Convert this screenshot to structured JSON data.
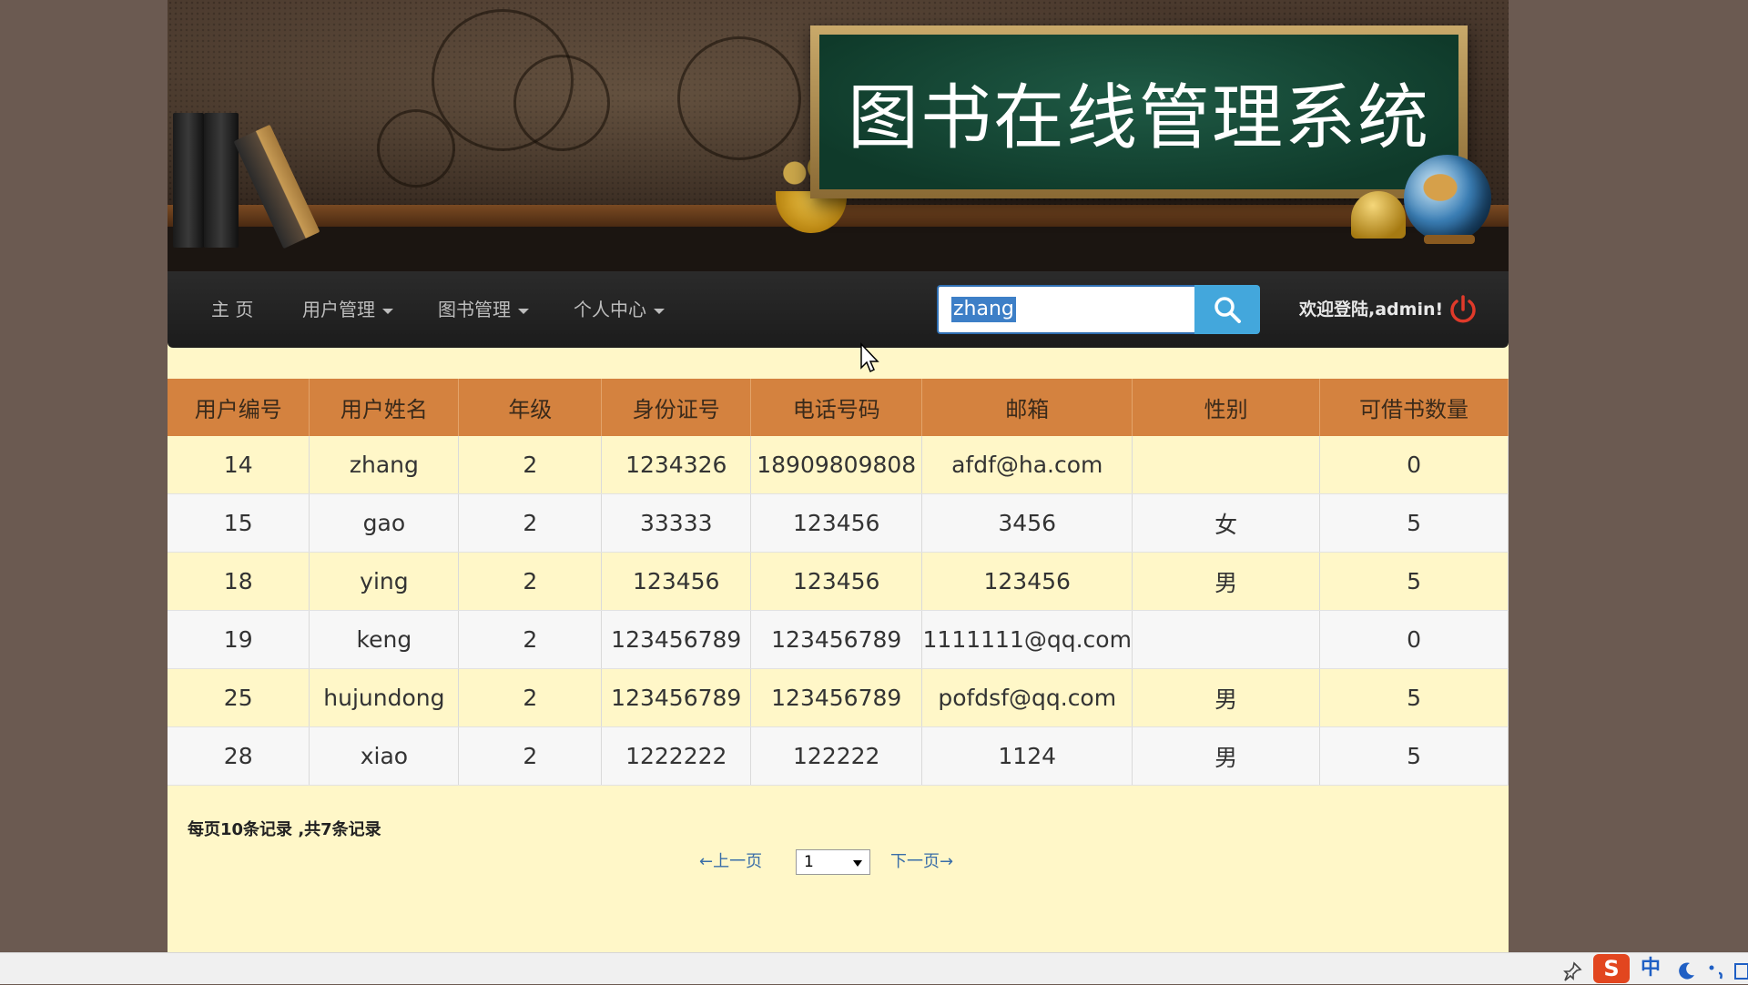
{
  "header": {
    "title": "图书在线管理系统"
  },
  "nav": {
    "home": "主 页",
    "user_mgmt": "用户管理",
    "book_mgmt": "图书管理",
    "personal": "个人中心",
    "search_value": "zhang",
    "welcome": "欢迎登陆,admin!"
  },
  "table": {
    "headers": [
      "用户编号",
      "用户姓名",
      "年级",
      "身份证号",
      "电话号码",
      "邮箱",
      "性别",
      "可借书数量"
    ],
    "rows": [
      [
        "14",
        "zhang",
        "2",
        "1234326",
        "18909809808",
        "afdf@ha.com",
        "",
        "0"
      ],
      [
        "15",
        "gao",
        "2",
        "33333",
        "123456",
        "3456",
        "女",
        "5"
      ],
      [
        "18",
        "ying",
        "2",
        "123456",
        "123456",
        "123456",
        "男",
        "5"
      ],
      [
        "19",
        "keng",
        "2",
        "123456789",
        "123456789",
        "1111111@qq.com",
        "",
        "0"
      ],
      [
        "25",
        "hujundong",
        "2",
        "123456789",
        "123456789",
        "pofdsf@qq.com",
        "男",
        "5"
      ],
      [
        "28",
        "xiao",
        "2",
        "1222222",
        "122222",
        "1124",
        "男",
        "5"
      ]
    ]
  },
  "footer": {
    "record_info": "每页10条记录 ,共7条记录",
    "prev": "←上一页",
    "next": "下一页→",
    "page_selected": "1"
  },
  "taskbar": {
    "ime_label": "中"
  },
  "colors": {
    "accent": "#d4823f",
    "search_button": "#43a7dc",
    "page_bg": "#fff7c8",
    "logout_icon": "#e03a2a"
  },
  "icons": [
    "search-icon",
    "power-icon",
    "chevron-down-icon",
    "pin-icon",
    "sogou-icon",
    "moon-icon"
  ]
}
